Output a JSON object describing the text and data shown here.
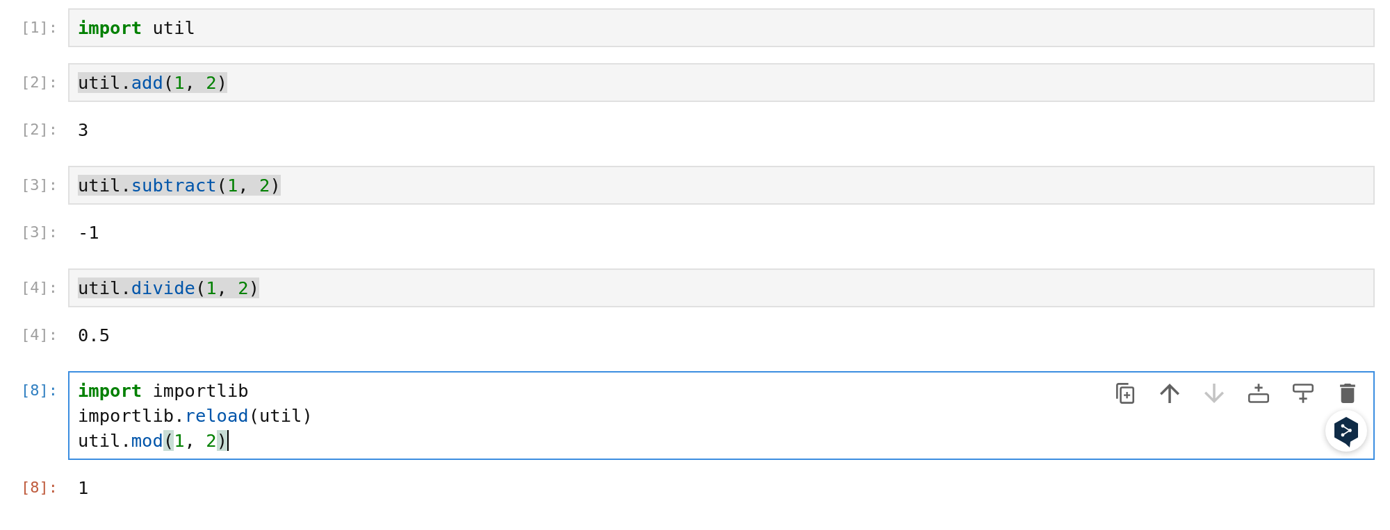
{
  "cells": [
    {
      "prompt": "[1]:",
      "selected": false,
      "lines": [
        {
          "highlighted": false,
          "cursor": false,
          "tokens": [
            {
              "kind": "keyword",
              "text": "import",
              "matched": false
            },
            {
              "kind": "plain",
              "text": " util",
              "matched": false
            }
          ]
        }
      ]
    },
    {
      "prompt": "[2]:",
      "selected": false,
      "lines": [
        {
          "highlighted": true,
          "cursor": false,
          "tokens": [
            {
              "kind": "plain",
              "text": "util.",
              "matched": false
            },
            {
              "kind": "property",
              "text": "add",
              "matched": false
            },
            {
              "kind": "plain",
              "text": "(",
              "matched": false
            },
            {
              "kind": "number",
              "text": "1",
              "matched": false
            },
            {
              "kind": "plain",
              "text": ", ",
              "matched": false
            },
            {
              "kind": "number",
              "text": "2",
              "matched": false
            },
            {
              "kind": "plain",
              "text": ")",
              "matched": false
            }
          ]
        }
      ],
      "output": {
        "prompt": "[2]:",
        "text": "3"
      }
    },
    {
      "prompt": "[3]:",
      "selected": false,
      "lines": [
        {
          "highlighted": true,
          "cursor": false,
          "tokens": [
            {
              "kind": "plain",
              "text": "util.",
              "matched": false
            },
            {
              "kind": "property",
              "text": "subtract",
              "matched": false
            },
            {
              "kind": "plain",
              "text": "(",
              "matched": false
            },
            {
              "kind": "number",
              "text": "1",
              "matched": false
            },
            {
              "kind": "plain",
              "text": ", ",
              "matched": false
            },
            {
              "kind": "number",
              "text": "2",
              "matched": false
            },
            {
              "kind": "plain",
              "text": ")",
              "matched": false
            }
          ]
        }
      ],
      "output": {
        "prompt": "[3]:",
        "text": "-1"
      }
    },
    {
      "prompt": "[4]:",
      "selected": false,
      "lines": [
        {
          "highlighted": true,
          "cursor": false,
          "tokens": [
            {
              "kind": "plain",
              "text": "util.",
              "matched": false
            },
            {
              "kind": "property",
              "text": "divide",
              "matched": false
            },
            {
              "kind": "plain",
              "text": "(",
              "matched": false
            },
            {
              "kind": "number",
              "text": "1",
              "matched": false
            },
            {
              "kind": "plain",
              "text": ", ",
              "matched": false
            },
            {
              "kind": "number",
              "text": "2",
              "matched": false
            },
            {
              "kind": "plain",
              "text": ")",
              "matched": false
            }
          ]
        }
      ],
      "output": {
        "prompt": "[4]:",
        "text": "0.5"
      }
    },
    {
      "prompt": "[8]:",
      "selected": true,
      "lines": [
        {
          "highlighted": false,
          "cursor": false,
          "tokens": [
            {
              "kind": "keyword",
              "text": "import",
              "matched": false
            },
            {
              "kind": "plain",
              "text": " importlib",
              "matched": false
            }
          ]
        },
        {
          "highlighted": false,
          "cursor": false,
          "tokens": [
            {
              "kind": "plain",
              "text": "importlib.",
              "matched": false
            },
            {
              "kind": "property",
              "text": "reload",
              "matched": false
            },
            {
              "kind": "plain",
              "text": "(util)",
              "matched": false
            }
          ]
        },
        {
          "highlighted": false,
          "cursor": true,
          "tokens": [
            {
              "kind": "plain",
              "text": "util.",
              "matched": false
            },
            {
              "kind": "property",
              "text": "mod",
              "matched": false
            },
            {
              "kind": "plain",
              "text": "(",
              "matched": true
            },
            {
              "kind": "number",
              "text": "1",
              "matched": false
            },
            {
              "kind": "plain",
              "text": ", ",
              "matched": false
            },
            {
              "kind": "number",
              "text": "2",
              "matched": false
            },
            {
              "kind": "plain",
              "text": ")",
              "matched": true
            }
          ]
        }
      ],
      "toolbar": [
        {
          "kind": "duplicate",
          "disabled": false
        },
        {
          "kind": "move_up",
          "disabled": false
        },
        {
          "kind": "move_down",
          "disabled": true
        },
        {
          "kind": "insert_above",
          "disabled": false
        },
        {
          "kind": "insert_below",
          "disabled": false
        },
        {
          "kind": "delete",
          "disabled": false
        }
      ],
      "output": {
        "prompt": "[8]:",
        "text": "1"
      }
    }
  ]
}
